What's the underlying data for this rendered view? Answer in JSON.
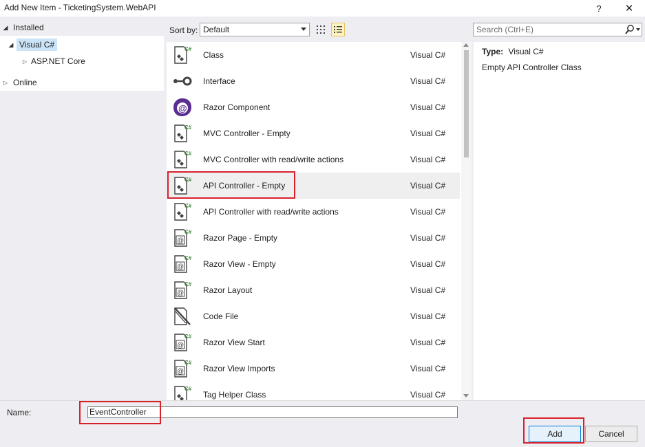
{
  "window": {
    "title": "Add New Item - TicketingSystem.WebAPI",
    "help_label": "?",
    "close_label": "✕"
  },
  "tree": {
    "installed_label": "Installed",
    "visual_csharp_label": "Visual C#",
    "aspnet_core_label": "ASP.NET Core",
    "online_label": "Online"
  },
  "toolbar": {
    "sort_label": "Sort by:",
    "sort_value": "Default",
    "search_placeholder": "Search (Ctrl+E)"
  },
  "items": [
    {
      "name": "Class",
      "lang": "Visual C#",
      "icon": "csharp-class-icon"
    },
    {
      "name": "Interface",
      "lang": "Visual C#",
      "icon": "interface-icon"
    },
    {
      "name": "Razor Component",
      "lang": "Visual C#",
      "icon": "razor-component-icon"
    },
    {
      "name": "MVC Controller - Empty",
      "lang": "Visual C#",
      "icon": "csharp-class-icon"
    },
    {
      "name": "MVC Controller with read/write actions",
      "lang": "Visual C#",
      "icon": "csharp-class-icon"
    },
    {
      "name": "API Controller - Empty",
      "lang": "Visual C#",
      "icon": "csharp-class-icon"
    },
    {
      "name": "API Controller with read/write actions",
      "lang": "Visual C#",
      "icon": "csharp-class-icon"
    },
    {
      "name": "Razor Page - Empty",
      "lang": "Visual C#",
      "icon": "razor-page-icon"
    },
    {
      "name": "Razor View - Empty",
      "lang": "Visual C#",
      "icon": "razor-page-icon"
    },
    {
      "name": "Razor Layout",
      "lang": "Visual C#",
      "icon": "razor-page-icon"
    },
    {
      "name": "Code File",
      "lang": "Visual C#",
      "icon": "code-file-icon"
    },
    {
      "name": "Razor View Start",
      "lang": "Visual C#",
      "icon": "razor-page-icon"
    },
    {
      "name": "Razor View Imports",
      "lang": "Visual C#",
      "icon": "razor-page-icon"
    },
    {
      "name": "Tag Helper Class",
      "lang": "Visual C#",
      "icon": "csharp-class-icon"
    }
  ],
  "selected_item": "API Controller - Empty",
  "detail": {
    "type_label": "Type:",
    "type_value": "Visual C#",
    "description": "Empty API Controller Class"
  },
  "footer": {
    "name_label": "Name:",
    "name_value": "EventController",
    "add_label": "Add",
    "cancel_label": "Cancel"
  },
  "colors": {
    "highlight_red": "#d8202a",
    "selection_blue": "#cce4f7",
    "razor_purple": "#5c2d91",
    "csharp_green": "#388a34"
  }
}
